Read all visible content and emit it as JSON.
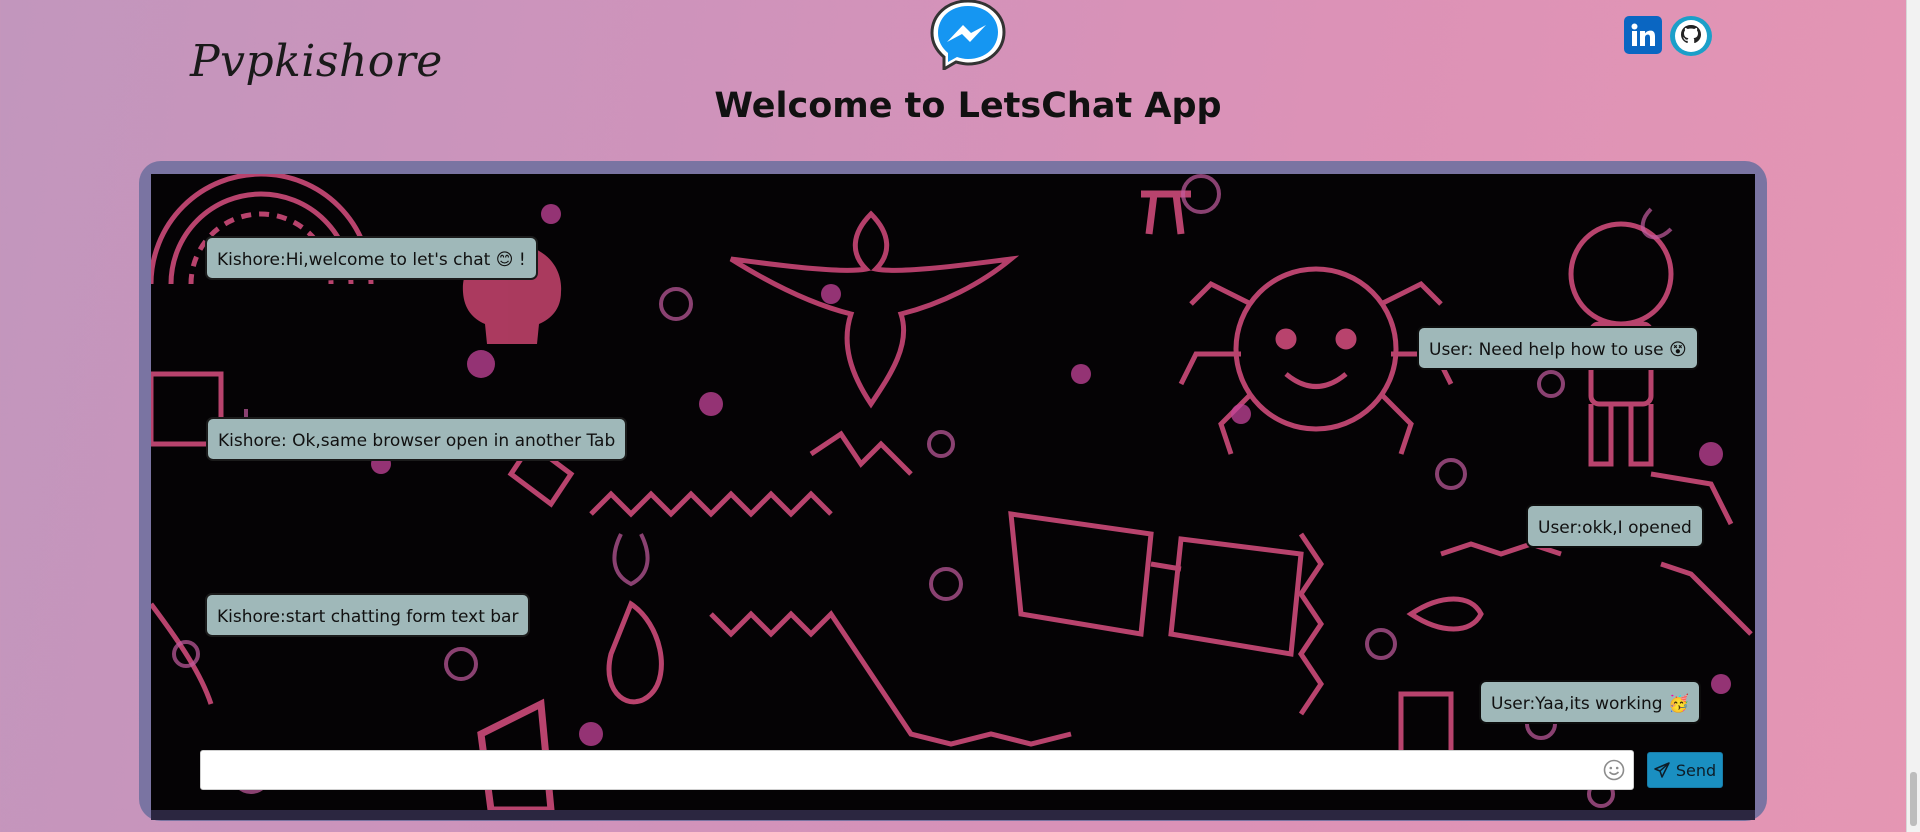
{
  "header": {
    "brand": "Pvpkishore",
    "title": "Welcome to LetsChat App",
    "logo_icon": "messenger-icon",
    "social": [
      {
        "name": "linkedin-icon",
        "color": "#0a66c2"
      },
      {
        "name": "github-icon",
        "color": "#1b9fc9"
      }
    ]
  },
  "chat": {
    "messages": [
      {
        "side": "left",
        "text": "Kishore:Hi,welcome to let's chat 😊 !"
      },
      {
        "side": "right",
        "text": "User: Need help how to use 😵"
      },
      {
        "side": "left",
        "text": "Kishore: Ok,same browser open in another Tab"
      },
      {
        "side": "right",
        "text": "User:okk,I opened"
      },
      {
        "side": "left",
        "text": "Kishore:start chatting form text bar"
      },
      {
        "side": "right",
        "text": "User:Yaa,its working 🥳"
      }
    ],
    "input": {
      "value": "",
      "placeholder": ""
    },
    "send_label": "Send",
    "send_icon": "paper-plane-icon",
    "emoji_icon": "smiley-icon"
  },
  "colors": {
    "bubble": "#9fb8b9",
    "frame": "#7a74a2",
    "send": "#1a8fc1",
    "doodle": "#d84f80"
  }
}
